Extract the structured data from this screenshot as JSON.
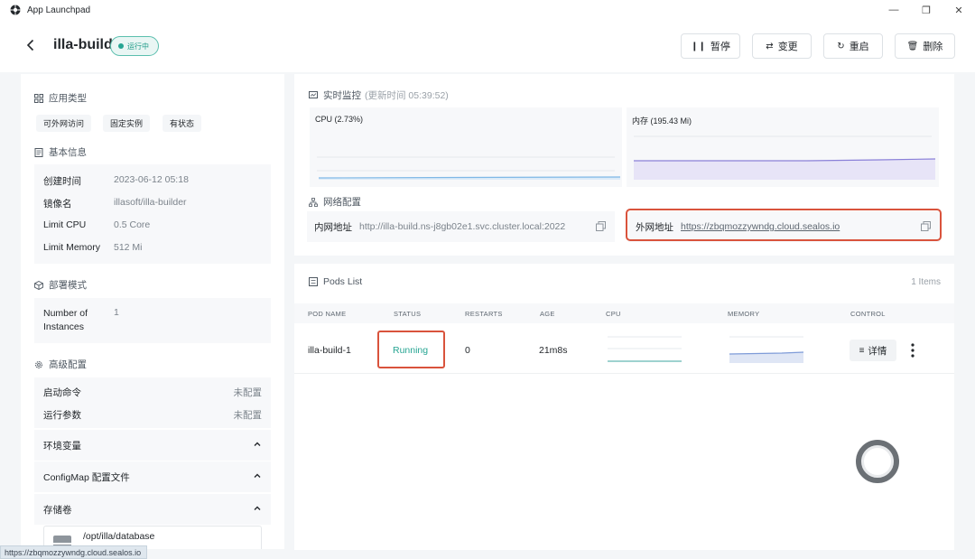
{
  "window": {
    "title": "App Launchpad",
    "minimize": "—",
    "maximize": "❐",
    "close": "✕"
  },
  "header": {
    "app_name": "illa-build",
    "status": "运行中",
    "actions": [
      {
        "icon": "pause-icon",
        "glyph": "❙❙",
        "label": "暂停"
      },
      {
        "icon": "swap-icon",
        "glyph": "⇄",
        "label": "变更"
      },
      {
        "icon": "restart-icon",
        "glyph": "↻",
        "label": "重启"
      },
      {
        "icon": "trash-icon",
        "glyph": "🗑",
        "label": "删除"
      }
    ]
  },
  "left": {
    "app_type": {
      "title": "应用类型",
      "tags": [
        "可外网访问",
        "固定实例",
        "有状态"
      ]
    },
    "basic": {
      "title": "基本信息",
      "rows": [
        {
          "k": "创建时间",
          "v": "2023-06-12 05:18"
        },
        {
          "k": "镜像名",
          "v": "illasoft/illa-builder"
        },
        {
          "k": "Limit CPU",
          "v": "0.5 Core"
        },
        {
          "k": "Limit Memory",
          "v": "512 Mi"
        }
      ]
    },
    "deploy": {
      "title": "部署模式",
      "k": "Number of Instances",
      "v": "1"
    },
    "advanced": {
      "title": "高级配置",
      "rows": [
        {
          "k": "启动命令",
          "v": "未配置"
        },
        {
          "k": "运行参数",
          "v": "未配置"
        }
      ],
      "sections": [
        "环境变量",
        "ConfigMap 配置文件",
        "存储卷"
      ],
      "volume_path": "/opt/illa/database"
    }
  },
  "monitor": {
    "title": "实时监控",
    "updated": "(更新时间 05:39:52)",
    "cpu_label": "CPU (2.73%)",
    "mem_label": "内存 (195.43 Mi)",
    "colors": {
      "cpu": "#7fb8e6",
      "mem": "#8a80d8"
    }
  },
  "network": {
    "title": "网络配置",
    "internal_label": "内网地址",
    "internal_url": "http://illa-build.ns-j8gb02e1.svc.cluster.local:2022",
    "external_label": "外网地址",
    "external_url": "https://zbqmozzywndg.cloud.sealos.io"
  },
  "pods": {
    "title": "Pods List",
    "count": "1 Items",
    "columns": [
      "POD NAME",
      "STATUS",
      "RESTARTS",
      "AGE",
      "CPU",
      "MEMORY",
      "CONTROL"
    ],
    "rows": [
      {
        "name": "illa-build-1",
        "status": "Running",
        "restarts": "0",
        "age": "21m8s",
        "detail": "详情"
      }
    ]
  },
  "statusbar": {
    "url": "https://zbqmozzywndg.cloud.sealos.io"
  }
}
